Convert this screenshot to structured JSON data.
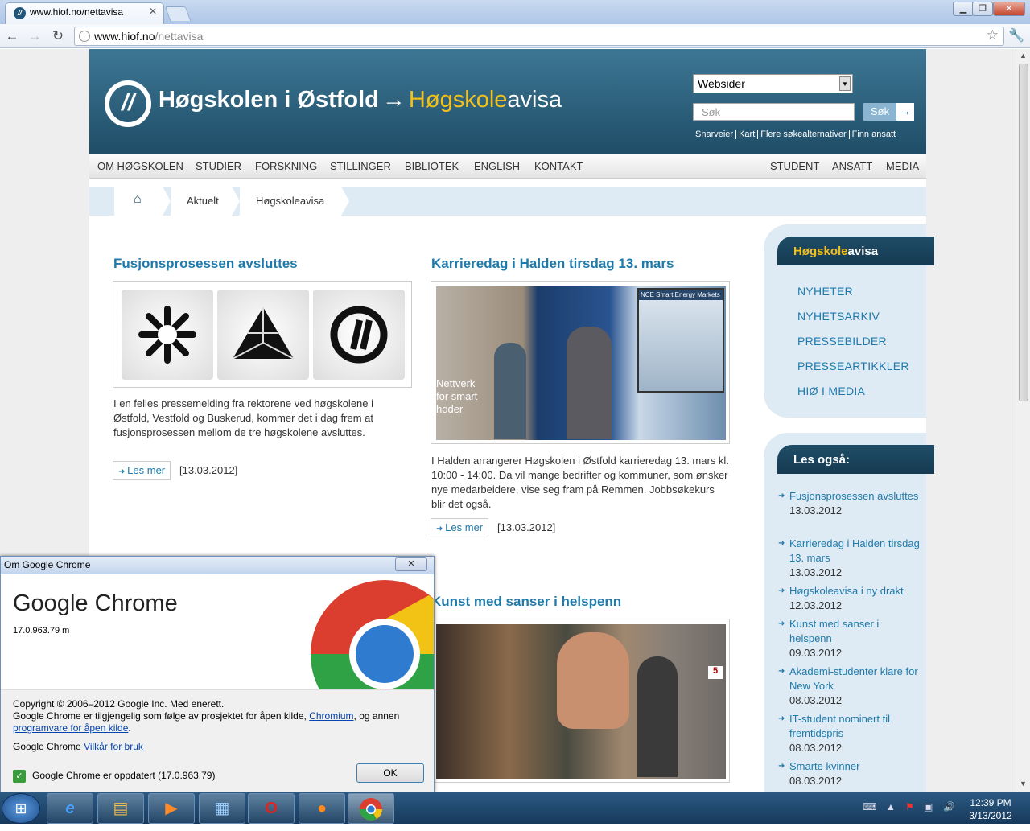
{
  "browser": {
    "tab_title": "www.hiof.no/nettavisa",
    "tab_favicon": "hiof-logo-icon",
    "url_host": "www.hiof.no",
    "url_path": "/nettavisa",
    "back": "←",
    "forward": "→",
    "reload": "↻",
    "star": "☆",
    "wrench": "🔧"
  },
  "site": {
    "logo_text_1": "Høgskolen i Østfold",
    "arrow": "→",
    "logo_text_2a": "Høgskole",
    "logo_text_2b": "avisa",
    "select_value": "Websider",
    "search_placeholder": "Søk",
    "search_button": "Søk",
    "quick_links": [
      "Snarveier",
      "Kart",
      "Flere søkealternativer",
      "Finn ansatt"
    ],
    "menu_left": [
      "OM HØGSKOLEN",
      "STUDIER",
      "FORSKNING",
      "STILLINGER",
      "BIBLIOTEK",
      "ENGLISH",
      "KONTAKT"
    ],
    "menu_right": [
      "STUDENT",
      "ANSATT",
      "MEDIA"
    ],
    "breadcrumb": [
      "Aktuelt",
      "Høgskoleavisa"
    ],
    "colors": {
      "header": "#1f4d67",
      "accent": "#f3c11a",
      "link": "#1e7aab"
    }
  },
  "articles": [
    {
      "title": "Fusjonsprosessen avsluttes",
      "body": "I en felles pressemelding fra rektorene ved høgskolene i Østfold, Vestfold og Buskerud, kommer det i dag frem at fusjonsprosessen mellom de tre høgskolene avsluttes.",
      "more": "Les mer",
      "date": "[13.03.2012]"
    },
    {
      "title": "Karrieredag i Halden tirsdag 13. mars",
      "body": "I Halden arrangerer Høgskolen i Østfold karrieredag 13. mars kl. 10:00 - 14:00. Da vil mange bedrifter og kommuner, som ønsker nye medarbeidere, vise seg fram på Remmen. Jobbsøkekurs blir det også.",
      "more": "Les mer",
      "date": "[13.03.2012]",
      "photo_text": "Nettverk for smart hoder",
      "photo_screen": "NCE Smart Energy Markets"
    },
    {
      "title": "Kunst med sanser i helspenn",
      "photo_number": "5"
    }
  ],
  "sidebar": {
    "box1_title_a": "Høgskole",
    "box1_title_b": "avisa",
    "links": [
      "NYHETER",
      "NYHETSARKIV",
      "PRESSEBILDER",
      "PRESSEARTIKKLER",
      "HIØ I MEDIA"
    ],
    "box2_title": "Les også:",
    "items": [
      {
        "title": "Fusjonsprosessen avsluttes",
        "date": "13.03.2012"
      },
      {
        "title": "Karrieredag i Halden tirsdag 13. mars",
        "date": "13.03.2012"
      },
      {
        "title": "Høgskoleavisa i ny drakt",
        "date": "12.03.2012"
      },
      {
        "title": "Kunst med sanser i helspenn",
        "date": "09.03.2012"
      },
      {
        "title": "Akademi-studenter klare for New York",
        "date": "08.03.2012"
      },
      {
        "title": "IT-student nominert til fremtidspris",
        "date": "08.03.2012"
      },
      {
        "title": "Smarte kvinner",
        "date": "08.03.2012"
      }
    ]
  },
  "dialog": {
    "window_title": "Om Google Chrome",
    "close": "✕",
    "product": "Google Chrome",
    "version": "17.0.963.79 m",
    "copyright": "Copyright © 2006–2012 Google Inc. Med enerett.",
    "line2a": "Google Chrome er tilgjengelig som følge av prosjektet for åpen kilde,",
    "chromium": "Chromium",
    "line2b": ", og annen",
    "oss_link": "programvare for åpen kilde",
    "period": ".",
    "tos_prefix": "Google Chrome",
    "tos_link": "Vilkår for bruk",
    "status": "Google Chrome er oppdatert (17.0.963.79)",
    "ok": "OK"
  },
  "taskbar": {
    "start": "⊞",
    "apps": [
      "internet-explorer-icon",
      "explorer-icon",
      "media-player-icon",
      "control-panel-icon",
      "opera-icon",
      "firefox-icon",
      "chrome-icon"
    ],
    "time": "12:39 PM",
    "date": "3/13/2012"
  }
}
